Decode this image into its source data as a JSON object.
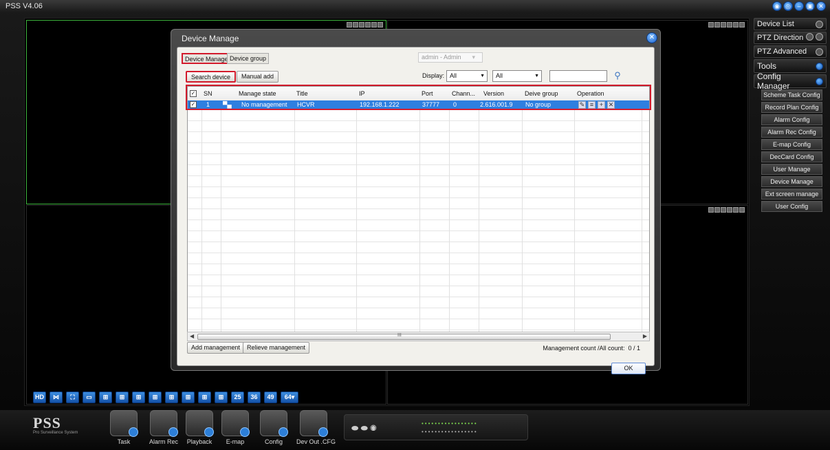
{
  "app": {
    "title": "PSS V4.06"
  },
  "right_panel": {
    "device_list": "Device List",
    "ptz_direction": "PTZ Direction",
    "ptz_advanced": "PTZ Advanced",
    "tools": "Tools",
    "config_manager": "Config Manager",
    "items": [
      "Scheme Task Config",
      "Record Plan Config",
      "Alarm Config",
      "Alarm Rec Config",
      "E-map Config",
      "DecCard Config",
      "User Manage",
      "Device Manage",
      "Ext screen manage",
      "User Config"
    ]
  },
  "layout_bar": {
    "hd": "HD",
    "n25": "25",
    "n36": "36",
    "n49": "49",
    "n64": "64▾"
  },
  "dock": {
    "brand": "PSS",
    "brand_sub": "Pro Surveillance System",
    "items": [
      "Task",
      "Alarm Rec",
      "Playback",
      "E-map",
      "Config",
      "Dev Out .CFG"
    ]
  },
  "dialog": {
    "title": "Device Manage",
    "tab_manage": "Device Manage",
    "tab_group": "Device group",
    "user": "admin - Admin",
    "search_btn": "Search device",
    "manual_add_btn": "Manual add",
    "display_label": "Display:",
    "display_value": "All",
    "filter_value": "All",
    "search_value": "",
    "columns": {
      "sn": "SN",
      "manage_state": "Manage state",
      "title": "Title",
      "ip": "IP",
      "port": "Port",
      "channel": "Chann...",
      "version": "Version",
      "group": "Deive group",
      "operation": "Operation"
    },
    "row": {
      "sn": "1",
      "manage_state": "No management",
      "title": "HCVR",
      "ip": "192.168.1.222",
      "port": "37777",
      "channel": "0",
      "version": "2.616.001.9",
      "group": "No group"
    },
    "scroll_mark": "III",
    "add_mgmt_btn": "Add management",
    "relieve_mgmt_btn": "Relieve management",
    "count_label": "Management count /All count:",
    "count_value": "0 / 1",
    "ok": "OK"
  }
}
